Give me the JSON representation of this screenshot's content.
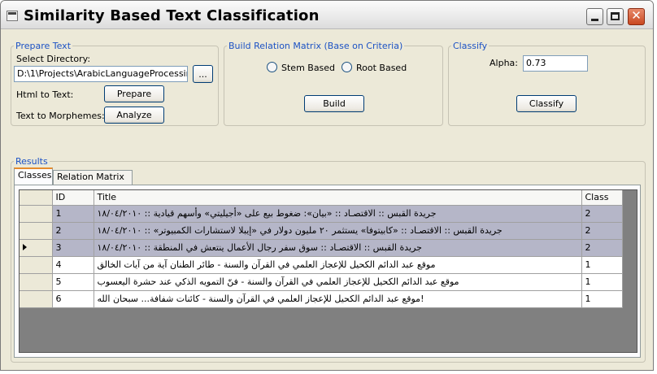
{
  "window": {
    "title": "Similarity Based Text Classification"
  },
  "prepare": {
    "legend": "Prepare Text",
    "select_dir_label": "Select Directory:",
    "directory_value": "D:\\1\\Projects\\ArabicLanguageProcessing\\Ap",
    "browse_label": "...",
    "html_to_text_label": "Html to Text:",
    "prepare_button": "Prepare",
    "text_to_morphemes_label": "Text to Morphemes:",
    "analyze_button": "Analyze"
  },
  "build": {
    "legend": "Build Relation Matrix (Base on Criteria)",
    "stem_label": "Stem Based",
    "root_label": "Root Based",
    "build_button": "Build"
  },
  "classify": {
    "legend": "Classify",
    "alpha_label": "Alpha:",
    "alpha_value": "0.73",
    "classify_button": "Classify"
  },
  "results": {
    "legend": "Results",
    "tabs": [
      "Classes",
      "Relation Matrix"
    ],
    "columns": {
      "id": "ID",
      "title": "Title",
      "class": "Class"
    },
    "rows": [
      {
        "id": "1",
        "title": "جريدة القبس :: الاقتصـاد :: «بيان»: ضغوط بيع على «أجيليتي» وأسهم قيادية :: ١٨/٠٤/٢٠١٠",
        "class": "2",
        "selected": true
      },
      {
        "id": "2",
        "title": "جريدة القبس :: الاقتصـاد :: «كابيتوفا» يستثمر ٢٠ مليون دولار في «إيبلا لاستشارات الكمبيوتر» :: ١٨/٠٤/٢٠١٠",
        "class": "2",
        "selected": true
      },
      {
        "id": "3",
        "title": "جريدة القبس :: الاقتصـاد :: سوق سفر رجال الأعمال ينتعش في المنطقة :: ١٨/٠٤/٢٠١٠",
        "class": "2",
        "selected": true,
        "current": true
      },
      {
        "id": "4",
        "title": "موقع عبد الدائم الكحيل للإعجاز العلمي في القرآن والسنة - طائر الطنان آية من آيات الخالق",
        "class": "1",
        "selected": false
      },
      {
        "id": "5",
        "title": "موقع عبد الدائم الكحيل للإعجاز العلمي في القرآن والسنة - فنّ التمويه الذكي عند حشرة اليعسوب",
        "class": "1",
        "selected": false
      },
      {
        "id": "6",
        "title": "!موقع عبد الدائم الكحيل للإعجاز العلمي في القرآن والسنة - كائنات شفافة... سبحان الله",
        "class": "1",
        "selected": false
      }
    ]
  },
  "icons": {
    "app": "app-window-icon",
    "minimize": "minimize-icon",
    "maximize": "maximize-icon",
    "close": "close-icon",
    "row_pointer": "current-row-arrow-icon"
  },
  "colors": {
    "legend": "#1c52c4",
    "selected_row": "#b5b6c8",
    "grid_background": "#808080",
    "active_tab_accent": "#e68b2c"
  }
}
